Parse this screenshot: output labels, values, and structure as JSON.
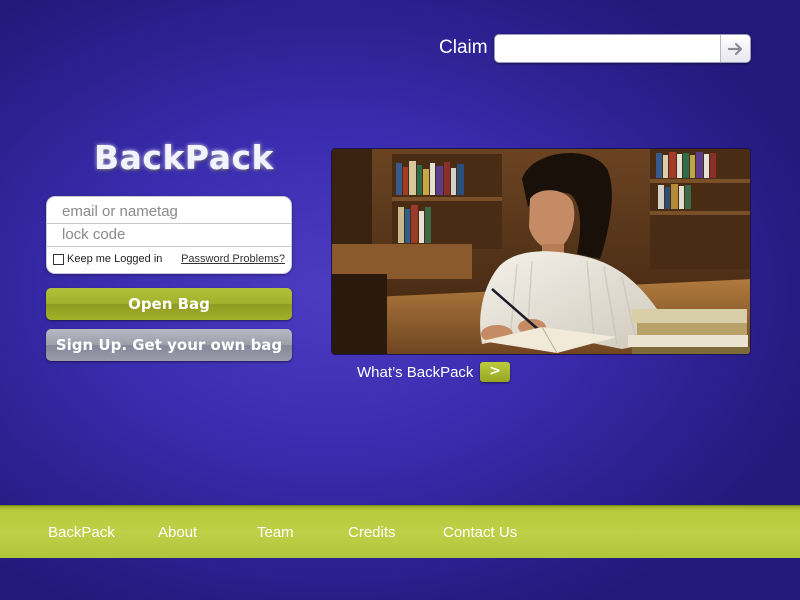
{
  "claim": {
    "label": "Claim",
    "input_value": "",
    "go_icon": "arrow-right-icon"
  },
  "brand": {
    "title": "BackPack"
  },
  "login": {
    "email_placeholder": "email or nametag",
    "lock_placeholder": "lock code",
    "keep_logged_in_label": "Keep me Logged in",
    "keep_logged_in_checked": false,
    "password_link": "Password Problems?"
  },
  "buttons": {
    "open_bag": "Open Bag",
    "sign_up": "Sign Up. Get your own bag"
  },
  "feature": {
    "link_label": "What’s BackPack",
    "go_label": ">"
  },
  "footer": {
    "items": [
      {
        "label": "BackPack"
      },
      {
        "label": "About"
      },
      {
        "label": "Team"
      },
      {
        "label": "Credits"
      },
      {
        "label": "Contact Us"
      }
    ]
  },
  "colors": {
    "background": "#3a2cae",
    "accent_green": "#a4b12a",
    "button_gray": "#9d9dab",
    "footer_green": "#bcd148"
  }
}
